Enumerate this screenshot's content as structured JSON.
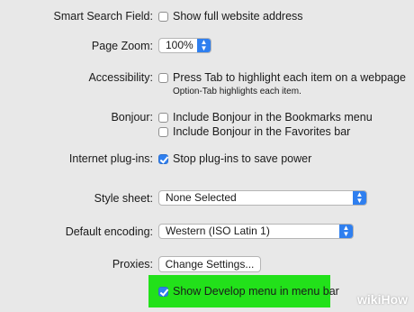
{
  "rows": {
    "smart_search": {
      "label": "Smart Search Field:",
      "option": "Show full website address"
    },
    "page_zoom": {
      "label": "Page Zoom:",
      "value": "100%"
    },
    "accessibility": {
      "label": "Accessibility:",
      "option": "Press Tab to highlight each item on a webpage",
      "hint": "Option-Tab highlights each item."
    },
    "bonjour": {
      "label": "Bonjour:",
      "option1": "Include Bonjour in the Bookmarks menu",
      "option2": "Include Bonjour in the Favorites bar"
    },
    "plugins": {
      "label": "Internet plug-ins:",
      "option": "Stop plug-ins to save power"
    },
    "style_sheet": {
      "label": "Style sheet:",
      "value": "None Selected"
    },
    "encoding": {
      "label": "Default encoding:",
      "value": "Western (ISO Latin 1)"
    },
    "proxies": {
      "label": "Proxies:",
      "button": "Change Settings..."
    },
    "develop": {
      "option": "Show Develop menu in menu bar"
    }
  },
  "watermark": "wikiHow",
  "colors": {
    "highlight": "#22e11a",
    "accent": "#2f7fef",
    "background": "#e8e8e8"
  }
}
